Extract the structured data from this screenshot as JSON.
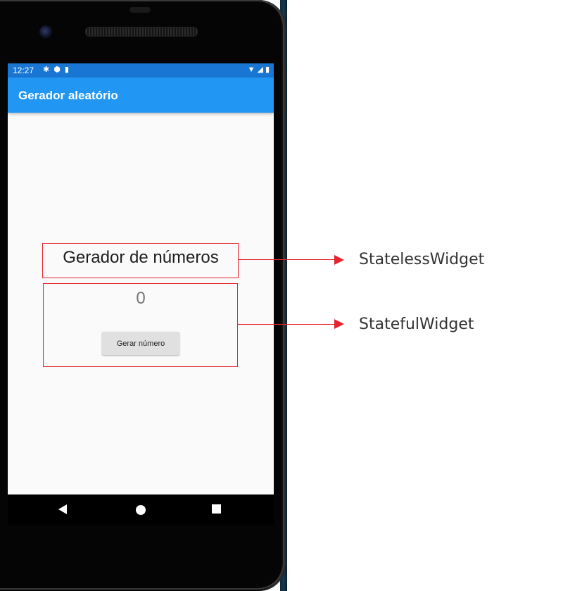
{
  "status_bar": {
    "time": "12:27",
    "left_icons": [
      "settings-icon",
      "shield-icon",
      "sd-card-icon"
    ],
    "right_icons": [
      "wifi-icon",
      "signal-icon",
      "battery-icon"
    ]
  },
  "app_bar": {
    "title": "Gerador aleatório",
    "color": "#2196f3",
    "status_color": "#1976d2"
  },
  "content": {
    "heading": "Gerador de números",
    "counter_value": "0",
    "generate_button_label": "Gerar número"
  },
  "navigation": {
    "buttons": [
      "back-icon",
      "home-icon",
      "recents-icon"
    ]
  },
  "annotations": {
    "color": "#e8242e",
    "stateless_label": "StatelessWidget",
    "stateful_label": "StatefulWidget"
  }
}
